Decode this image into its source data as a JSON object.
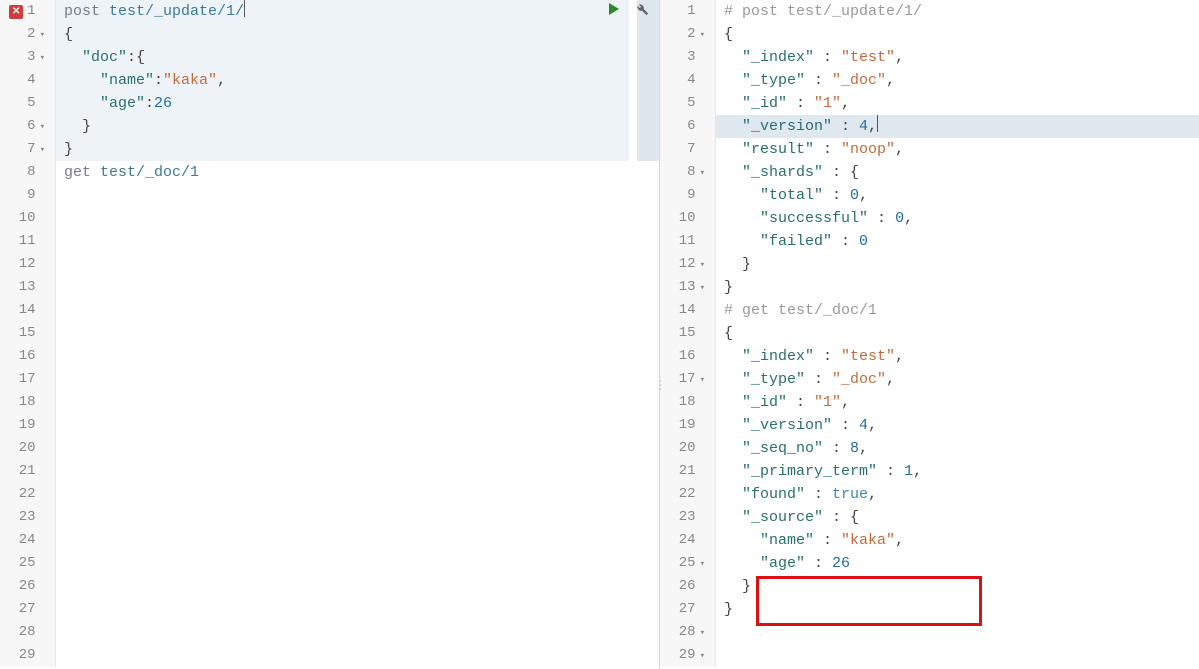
{
  "icons": {
    "play": "play-icon",
    "wrench": "wrench-icon",
    "error": "error-icon"
  },
  "left": {
    "gutter": [
      "1",
      "2",
      "3",
      "4",
      "5",
      "6",
      "7",
      "8",
      "9",
      "10",
      "11",
      "12",
      "13",
      "14",
      "15",
      "16",
      "17",
      "18",
      "19",
      "20",
      "21",
      "22",
      "23",
      "24",
      "25",
      "26",
      "27",
      "28",
      "29"
    ],
    "folds": {
      "2": true,
      "3": true,
      "6": true,
      "7": true
    },
    "errorAt": 1,
    "highlightRange": [
      1,
      7
    ],
    "lines": [
      {
        "method": "post",
        "url": "test/_update/1/",
        "cursor": true
      },
      {
        "raw": "{"
      },
      {
        "indent": 1,
        "key": "doc",
        "after": ":{"
      },
      {
        "indent": 2,
        "key": "name",
        "valstr": "kaka",
        "comma": true
      },
      {
        "indent": 2,
        "key": "age",
        "valnum": "26"
      },
      {
        "indent": 1,
        "raw": "}"
      },
      {
        "raw": "}"
      },
      {
        "raw": ""
      },
      {
        "method": "get",
        "url": "test/_doc/1"
      },
      {
        "raw": ""
      },
      {
        "raw": ""
      },
      {
        "raw": ""
      },
      {
        "raw": ""
      },
      {
        "raw": ""
      },
      {
        "raw": ""
      },
      {
        "raw": ""
      },
      {
        "raw": ""
      },
      {
        "raw": ""
      },
      {
        "raw": ""
      },
      {
        "raw": ""
      },
      {
        "raw": ""
      },
      {
        "raw": ""
      },
      {
        "raw": ""
      },
      {
        "raw": ""
      },
      {
        "raw": ""
      },
      {
        "raw": ""
      },
      {
        "raw": ""
      },
      {
        "raw": ""
      },
      {
        "raw": ""
      }
    ]
  },
  "right": {
    "gutter": [
      "1",
      "2",
      "3",
      "4",
      "5",
      "6",
      "7",
      "8",
      "9",
      "10",
      "11",
      "12",
      "13",
      "14",
      "15",
      "16",
      "17",
      "18",
      "19",
      "20",
      "21",
      "22",
      "23",
      "24",
      "25",
      "26",
      "27",
      "28",
      "29"
    ],
    "folds": {
      "2": true,
      "8": true,
      "12": true,
      "13": true,
      "17": true,
      "25": true,
      "28": true,
      "29": true
    },
    "highlightLine": 6,
    "redBoxLines": [
      26,
      27
    ],
    "lines": [
      {
        "comment": "# post test/_update/1/"
      },
      {
        "raw": "{"
      },
      {
        "indent": 1,
        "key": "_index",
        "valstr": "test",
        "comma": true
      },
      {
        "indent": 1,
        "key": "_type",
        "valstr": "_doc",
        "comma": true
      },
      {
        "indent": 1,
        "key": "_id",
        "valstr": "1",
        "comma": true
      },
      {
        "indent": 1,
        "key": "_version",
        "valnum": "4",
        "comma": true,
        "cursor": true
      },
      {
        "indent": 1,
        "key": "result",
        "valstr": "noop",
        "comma": true
      },
      {
        "indent": 1,
        "key": "_shards",
        "after": " : {"
      },
      {
        "indent": 2,
        "key": "total",
        "valnum": "0",
        "comma": true
      },
      {
        "indent": 2,
        "key": "successful",
        "valnum": "0",
        "comma": true
      },
      {
        "indent": 2,
        "key": "failed",
        "valnum": "0"
      },
      {
        "indent": 1,
        "raw": "}"
      },
      {
        "raw": "}"
      },
      {
        "raw": ""
      },
      {
        "raw": ""
      },
      {
        "comment": "# get test/_doc/1"
      },
      {
        "raw": "{"
      },
      {
        "indent": 1,
        "key": "_index",
        "valstr": "test",
        "comma": true
      },
      {
        "indent": 1,
        "key": "_type",
        "valstr": "_doc",
        "comma": true
      },
      {
        "indent": 1,
        "key": "_id",
        "valstr": "1",
        "comma": true
      },
      {
        "indent": 1,
        "key": "_version",
        "valnum": "4",
        "comma": true
      },
      {
        "indent": 1,
        "key": "_seq_no",
        "valnum": "8",
        "comma": true
      },
      {
        "indent": 1,
        "key": "_primary_term",
        "valnum": "1",
        "comma": true
      },
      {
        "indent": 1,
        "key": "found",
        "valbool": "true",
        "comma": true
      },
      {
        "indent": 1,
        "key": "_source",
        "after": " : {"
      },
      {
        "indent": 2,
        "key": "name",
        "valstr": "kaka",
        "comma": true
      },
      {
        "indent": 2,
        "key": "age",
        "valnum": "26"
      },
      {
        "indent": 1,
        "raw": "}"
      },
      {
        "raw": "}"
      }
    ]
  }
}
